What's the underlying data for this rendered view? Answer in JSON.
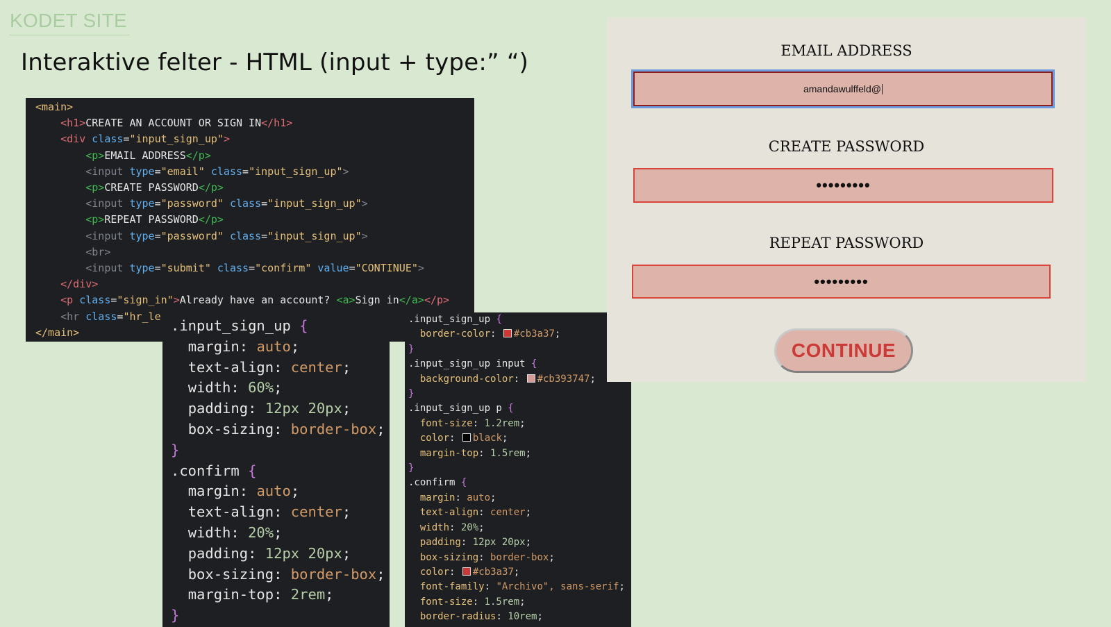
{
  "brand": "KODET SITE",
  "slide_title": "Interaktive felter - HTML (input + type:” “)",
  "html_code": {
    "l1": "<main>",
    "l2_open": "<h1>",
    "l2_text": "CREATE AN ACCOUNT OR SIGN IN",
    "l2_close": "</h1>",
    "l3_open": "<div",
    "l3_attr": "class",
    "l3_val": "\"input_sign_up\"",
    "l3_end": ">",
    "l4_open": "<p>",
    "l4_text": "EMAIL ADDRESS",
    "l4_close": "</p>",
    "l5_tag": "<input",
    "l5_a1": "type",
    "l5_v1": "\"email\"",
    "l5_a2": "class",
    "l5_v2": "\"input_sign_up\"",
    "l5_end": ">",
    "l6_open": "<p>",
    "l6_text": "CREATE PASSWORD",
    "l6_close": "</p>",
    "l7_tag": "<input",
    "l7_a1": "type",
    "l7_v1": "\"password\"",
    "l7_a2": "class",
    "l7_v2": "\"input_sign_up\"",
    "l7_end": ">",
    "l8_open": "<p>",
    "l8_text": "REPEAT PASSWORD",
    "l8_close": "</p>",
    "l9_tag": "<input",
    "l9_a1": "type",
    "l9_v1": "\"password\"",
    "l9_a2": "class",
    "l9_v2": "\"input_sign_up\"",
    "l9_end": ">",
    "l10": "<br>",
    "l11_tag": "<input",
    "l11_a1": "type",
    "l11_v1": "\"submit\"",
    "l11_a2": "class",
    "l11_v2": "\"confirm\"",
    "l11_a3": "value",
    "l11_v3": "\"CONTINUE\"",
    "l11_end": ">",
    "l12": "</div>",
    "l13_open": "<p",
    "l13_attr": "class",
    "l13_val": "\"sign_in\"",
    "l13_gt": ">",
    "l13_text": "Already have an account? ",
    "l13_a": "<a>",
    "l13_link": "Sign in",
    "l13_aclose": "</a>",
    "l13_close": "</p>",
    "l14_tag": "<hr",
    "l14_attr": "class",
    "l14_val": "\"hr_le",
    "l15": "</main>"
  },
  "css_big": {
    "sel1": ".input_sign_up",
    "r1_p1": "margin",
    "r1_v1": "auto",
    "r1_p2": "text-align",
    "r1_v2": "center",
    "r1_p3": "width",
    "r1_v3": "60%",
    "r1_p4": "padding",
    "r1_v4": "12px 20px",
    "r1_p5": "box-sizing",
    "r1_v5": "border-box",
    "sel2": ".confirm",
    "r2_p1": "margin",
    "r2_v1": "auto",
    "r2_p2": "text-align",
    "r2_v2": "center",
    "r2_p3": "width",
    "r2_v3": "20%",
    "r2_p4": "padding",
    "r2_v4": "12px 20px",
    "r2_p5": "box-sizing",
    "r2_v5": "border-box",
    "r2_p6": "margin-top",
    "r2_v6": "2rem"
  },
  "css_right": {
    "sel1": ".input_sign_up",
    "p1": "border-color",
    "v1": "#cb3a37",
    "sel2": ".input_sign_up input",
    "p2": "background-color",
    "v2": "#cb393747",
    "sel3": ".input_sign_up p",
    "p3a": "font-size",
    "v3a": "1.2rem",
    "p3b": "color",
    "v3b": "black",
    "p3c": "margin-top",
    "v3c": "1.5rem",
    "sel4": ".confirm",
    "p4a": "margin",
    "v4a": "auto",
    "p4b": "text-align",
    "v4b": "center",
    "p4c": "width",
    "v4c": "20%",
    "p4d": "padding",
    "v4d": "12px 20px",
    "p4e": "box-sizing",
    "v4e": "border-box",
    "p4f": "color",
    "v4f": "#cb3a37",
    "p4g": "font-family",
    "v4g": "\"Archivo\", sans-serif",
    "p4h": "font-size",
    "v4h": "1.5rem",
    "p4i": "border-radius",
    "v4i": "10rem"
  },
  "form": {
    "email_label": "EMAIL ADDRESS",
    "email_value": "amandawulffeld@",
    "create_label": "CREATE PASSWORD",
    "create_value": "•••••••••",
    "repeat_label": "REPEAT PASSWORD",
    "repeat_value": "•••••••••",
    "continue_label": "CONTINUE"
  },
  "colors": {
    "accent": "#cb3a37",
    "input_bg": "#deb4aa",
    "slide_bg": "#d9e9d1",
    "panel_bg": "#e6e3da",
    "focus_ring": "#6e9ae0"
  }
}
